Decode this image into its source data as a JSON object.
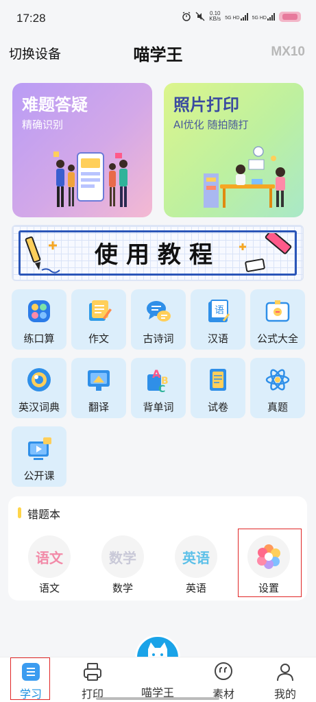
{
  "status_bar": {
    "time": "17:28",
    "net_speed_value": "0.10",
    "net_speed_unit": "KB/s",
    "sim1_label": "5G HD",
    "sim2_label": "5G HD",
    "icons": [
      "alarm-icon",
      "mute-icon",
      "signal-icon",
      "battery-icon"
    ]
  },
  "header": {
    "switch_device": "切换设备",
    "title": "喵学王",
    "model": "MX10"
  },
  "hero_cards": [
    {
      "title": "难题答疑",
      "subtitle": "精确识别"
    },
    {
      "title": "照片打印",
      "subtitle": "AI优化 随拍随打"
    }
  ],
  "tutorial_banner": {
    "text": "使用教程"
  },
  "tools": [
    {
      "label": "练口算",
      "icon": "calculator-icon"
    },
    {
      "label": "作文",
      "icon": "writing-icon"
    },
    {
      "label": "古诗词",
      "icon": "poem-chat-icon"
    },
    {
      "label": "汉语",
      "icon": "chinese-book-icon"
    },
    {
      "label": "公式大全",
      "icon": "formula-card-icon"
    },
    {
      "label": "英汉词典",
      "icon": "dictionary-icon"
    },
    {
      "label": "翻译",
      "icon": "translate-icon"
    },
    {
      "label": "背单词",
      "icon": "abc-vocab-icon"
    },
    {
      "label": "试卷",
      "icon": "exam-paper-icon"
    },
    {
      "label": "真题",
      "icon": "atom-icon"
    },
    {
      "label": "公开课",
      "icon": "video-class-icon"
    }
  ],
  "wrong_book": {
    "title": "错题本",
    "items": [
      {
        "label": "语文",
        "badge": "语文",
        "color": "#f28aa8"
      },
      {
        "label": "数学",
        "badge": "数学",
        "color": "#c9c9d8"
      },
      {
        "label": "英语",
        "badge": "英语",
        "color": "#5cc0e8"
      },
      {
        "label": "设置",
        "icon": "settings-flower-icon"
      }
    ]
  },
  "bottom_nav": [
    {
      "label": "学习",
      "icon": "study-icon",
      "active": true
    },
    {
      "label": "打印",
      "icon": "printer-icon"
    },
    {
      "label": "喵学王",
      "icon": "cat-book-icon"
    },
    {
      "label": "素材",
      "icon": "material-chat-icon"
    },
    {
      "label": "我的",
      "icon": "profile-icon"
    }
  ],
  "colors": {
    "accent": "#1aa3e8",
    "tile_bg": "#dceefb",
    "highlight": "#e02424",
    "active_nav": "#1a8fe0"
  }
}
